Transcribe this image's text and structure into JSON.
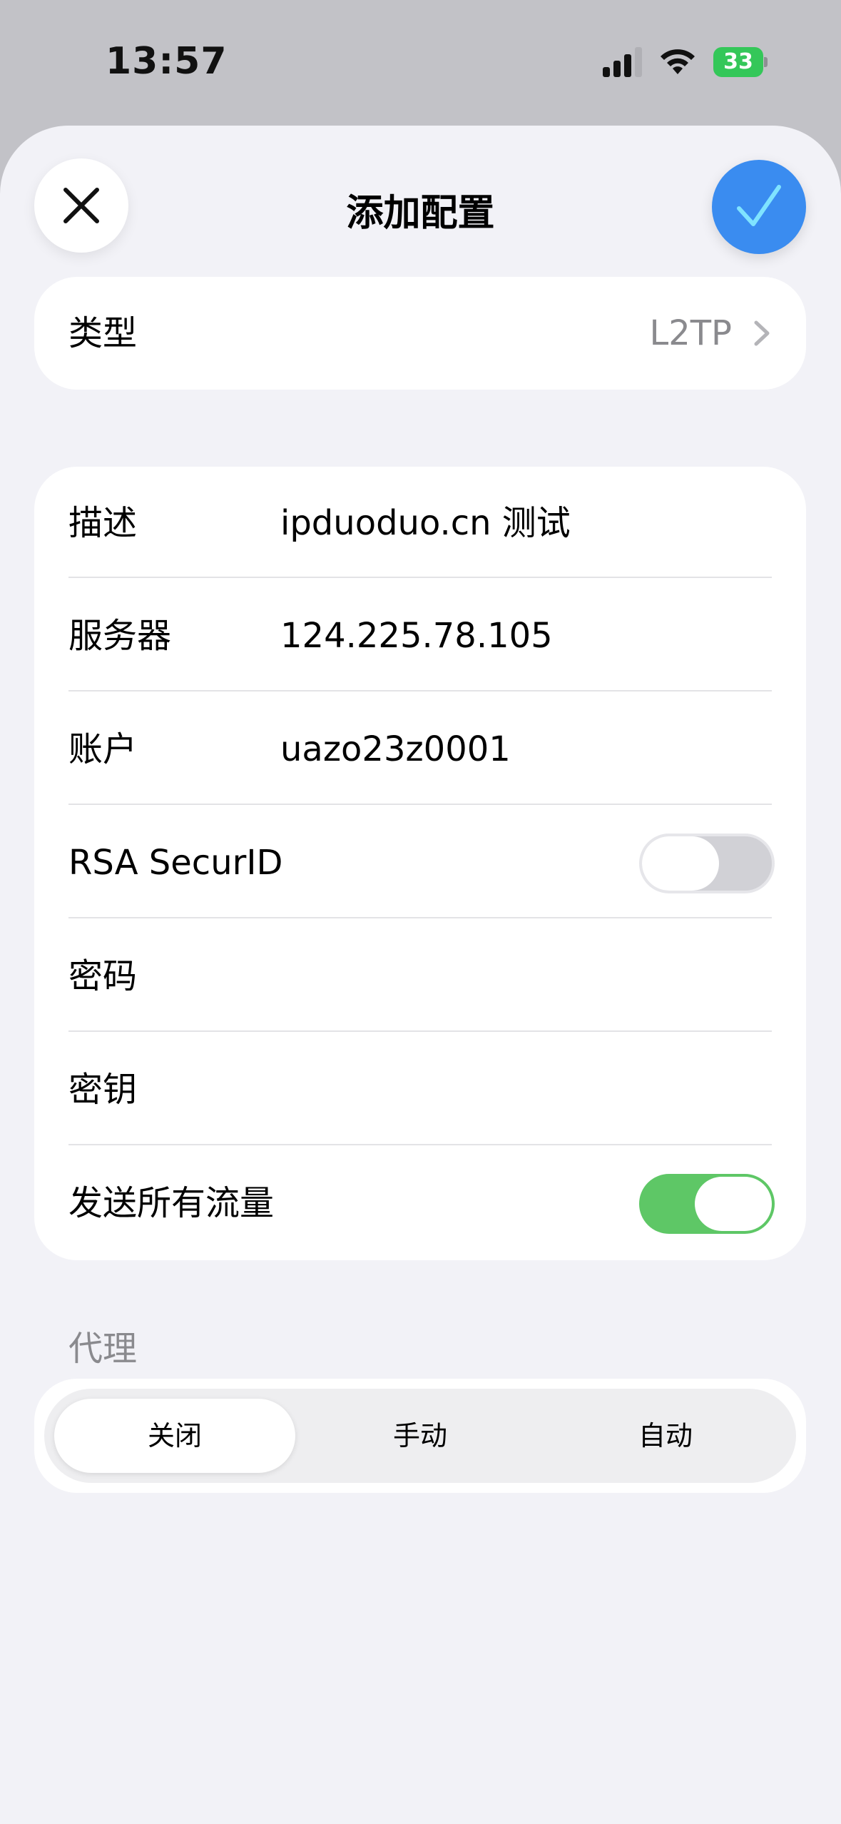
{
  "status_bar": {
    "time": "13:57",
    "battery_level": "33",
    "icons": [
      "cellular-signal-icon",
      "wifi-icon",
      "battery-charging-icon"
    ]
  },
  "header": {
    "title": "添加配置",
    "close_icon": "close-icon",
    "confirm_icon": "checkmark-icon"
  },
  "type_row": {
    "label": "类型",
    "value": "L2TP",
    "icon": "chevron-right-icon"
  },
  "form": {
    "description": {
      "label": "描述",
      "value": "ipduoduo.cn 测试"
    },
    "server": {
      "label": "服务器",
      "value": "124.225.78.105"
    },
    "account": {
      "label": "账户",
      "value": "uazo23z0001"
    },
    "rsa_securid": {
      "label": "RSA SecurID",
      "enabled": false
    },
    "password": {
      "label": "密码",
      "value": ""
    },
    "secret": {
      "label": "密钥",
      "value": ""
    },
    "send_all_traffic": {
      "label": "发送所有流量",
      "enabled": true
    }
  },
  "proxy": {
    "header": "代理",
    "options": [
      "关闭",
      "手动",
      "自动"
    ],
    "selected": "关闭"
  },
  "colors": {
    "accent_blue": "#3a8cf0",
    "toggle_on": "#5ec766",
    "toggle_off": "#d1d1d6",
    "secondary_text": "#8a8a8e",
    "sheet_background": "#f2f2f7"
  }
}
